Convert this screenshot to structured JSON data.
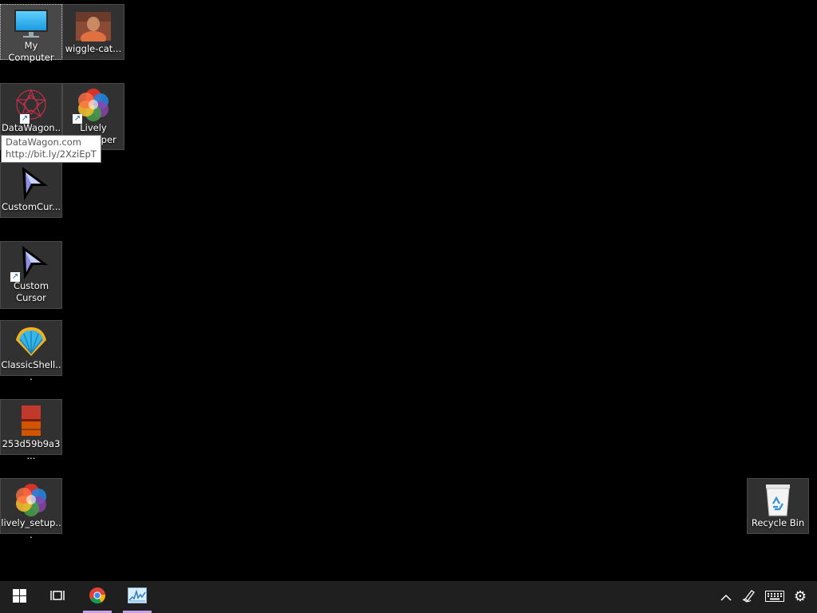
{
  "desktop_icons": [
    {
      "label": "My Computer",
      "icon": "monitor-icon"
    },
    {
      "label": "wiggle-cat...",
      "icon": "photo-thumbnail-icon"
    },
    {
      "label": "DataWagon...",
      "icon": "datawagon-icon"
    },
    {
      "label": "Lively Wallpaper",
      "icon": "lively-icon"
    },
    {
      "label": "CustomCur...",
      "icon": "cursor-icon"
    },
    {
      "label": "Custom Cursor",
      "icon": "cursor-icon"
    },
    {
      "label": "ClassicShell...",
      "icon": "shell-icon"
    },
    {
      "label": "253d59b9a3...",
      "icon": "archive-icon"
    },
    {
      "label": "lively_setup...",
      "icon": "lively-icon"
    },
    {
      "label": "Recycle Bin",
      "icon": "recycle-bin-icon"
    }
  ],
  "tooltip": {
    "line1": "DataWagon.com",
    "line2": "http://bit.ly/2XziEpT"
  },
  "taskbar": {
    "pinned": [
      {
        "name": "start",
        "icon": "windows-logo-icon"
      },
      {
        "name": "task-view",
        "icon": "task-view-icon"
      },
      {
        "name": "chrome",
        "icon": "chrome-icon"
      },
      {
        "name": "resource-monitor",
        "icon": "chart-app-icon"
      }
    ],
    "tray": [
      {
        "name": "show-hidden-icons",
        "icon": "chevron-up-icon"
      },
      {
        "name": "pen-workspace",
        "icon": "pen-icon"
      },
      {
        "name": "touch-keyboard",
        "icon": "keyboard-icon"
      },
      {
        "name": "settings",
        "icon": "gear-icon"
      }
    ]
  },
  "colors": {
    "desktop_background": "#000000",
    "taskbar_background": "#1f1f1f",
    "active_indicator": "#c9a1e6",
    "tooltip_background": "#ffffff"
  }
}
